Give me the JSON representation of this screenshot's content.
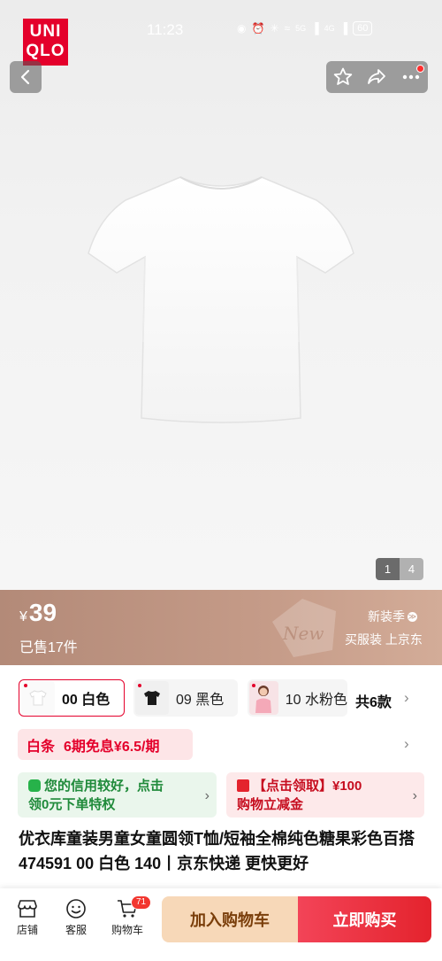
{
  "brand": {
    "logo_line1": "UNI",
    "logo_line2": "QLO",
    "accent": "#e4002b"
  },
  "status_bar": {
    "time": "11:23",
    "net1": "5G",
    "net2": "4G",
    "battery": "60"
  },
  "toolbar": {
    "back_icon": "chevron-left-icon",
    "favorite_icon": "star-icon",
    "share_icon": "share-icon",
    "more_icon": "more-icon"
  },
  "gallery": {
    "current": "1",
    "total": "4"
  },
  "price_banner": {
    "currency": "¥",
    "price": "39",
    "sold": "已售17件",
    "season": "新装季",
    "season_badge": "≫",
    "slogan": "买服装 上京东",
    "watermark": "New"
  },
  "colors": {
    "options": [
      {
        "label": "00 白色"
      },
      {
        "label": "09 黑色"
      },
      {
        "label": "10 水粉色"
      }
    ],
    "more": "共6款"
  },
  "baitiao": {
    "name": "白条",
    "offer": "6期免息¥6.5/期"
  },
  "promos": {
    "credit": {
      "line1": "您的信用较好，点击",
      "line2": "领0元下单特权"
    },
    "coupon": {
      "line1": "【点击领取】¥100",
      "line2": "购物立减金"
    }
  },
  "product": {
    "title": "优衣库童装男童女童圆领T恤/短袖全棉纯色糖果彩色百搭474591 00 白色 140丨京东快递 更快更好"
  },
  "bottom_bar": {
    "store": "店铺",
    "service": "客服",
    "cart": "购物车",
    "cart_count": "71",
    "add_to_cart": "加入购物车",
    "buy_now": "立即购买"
  }
}
